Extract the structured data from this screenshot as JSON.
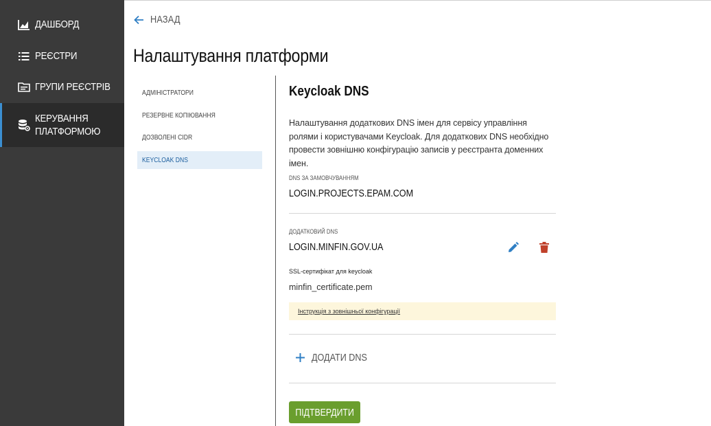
{
  "sidebar": {
    "items": [
      {
        "label": "ДАШБОРД",
        "icon": "chart-area-icon"
      },
      {
        "label": "РЕЄСТРИ",
        "icon": "list-icon"
      },
      {
        "label": "ГРУПИ РЕЄСТРІВ",
        "icon": "folder-icon"
      },
      {
        "label": "КЕРУВАННЯ\nПЛАТФОРМОЮ",
        "icon": "database-gear-icon",
        "active": true
      }
    ]
  },
  "header": {
    "back_label": "НАЗАД",
    "title": "Налаштування платформи"
  },
  "subnav": {
    "items": [
      {
        "label": "АДМІНІСТРАТОРИ"
      },
      {
        "label": "РЕЗЕРВНЕ КОПІЮВАННЯ"
      },
      {
        "label": "ДОЗВОЛЕНІ CIDR"
      },
      {
        "label": "KEYCLOAK DNS",
        "active": true
      }
    ]
  },
  "main": {
    "section_title": "Keycloak DNS",
    "description": "Налаштування додаткових DNS імен для сервісу управління ролями і користувачами Keycloak. Для додаткових DNS необхідно провести зовнішню конфігурацію записів у реєстранта доменних імен.",
    "default_dns_label": "DNS ЗА ЗАМОВЧУВАННЯМ",
    "default_dns_value": "LOGIN.PROJECTS.EPAM.COM",
    "extra_dns_label": "ДОДАТКОВИЙ DNS",
    "extra_dns_value": "LOGIN.MINFIN.GOV.UA",
    "ssl_label": "SSL-сертифікат для keycloak",
    "ssl_file": "minfin_certificate.pem",
    "instruction_link": "Інструкція з зовнішньої конфігурації",
    "add_dns_label": "ДОДАТИ DNS",
    "confirm_label": "ПІДТВЕРДИТИ"
  },
  "colors": {
    "sidebar_bg": "#3a3a3a",
    "active_accent": "#3b8fd1",
    "edit_icon": "#2f7fc4",
    "delete_icon": "#c0412b",
    "confirm_button": "#6a9e2e",
    "note_bg": "#fdf6dc"
  }
}
